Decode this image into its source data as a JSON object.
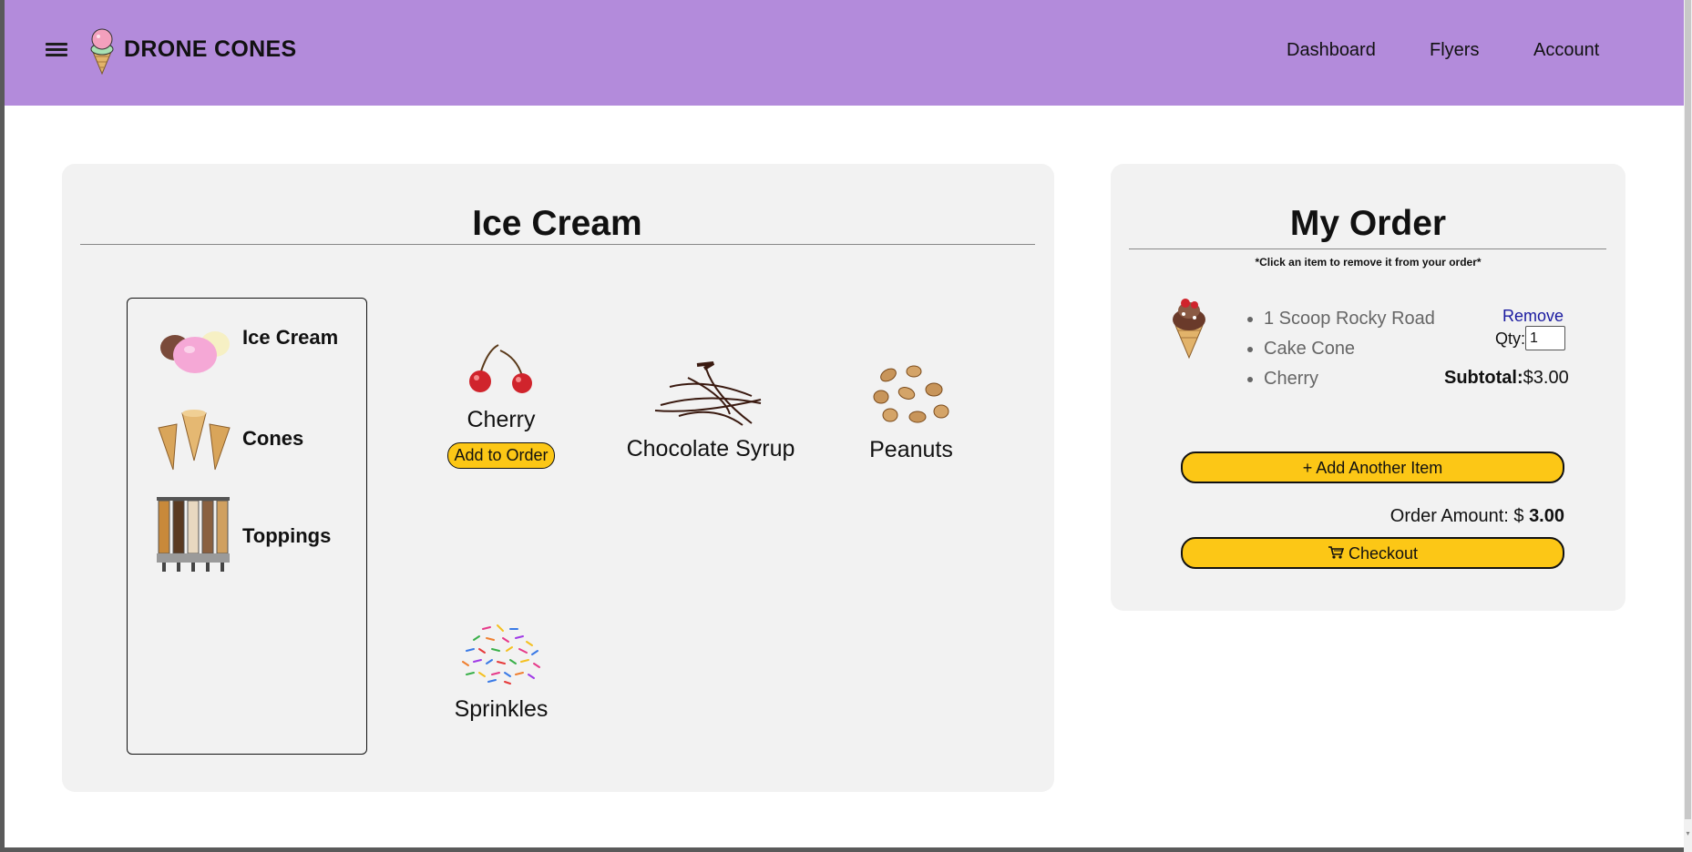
{
  "header": {
    "brand": "DRONE CONES",
    "nav": [
      "Dashboard",
      "Flyers",
      "Account"
    ]
  },
  "menu": {
    "title": "Ice Cream",
    "categories": [
      {
        "label": "Ice Cream",
        "icon": "ice-cream-scoops-icon"
      },
      {
        "label": "Cones",
        "icon": "cones-icon"
      },
      {
        "label": "Toppings",
        "icon": "toppings-dispenser-icon"
      }
    ],
    "products": [
      {
        "name": "Cherry",
        "icon": "cherry-icon",
        "action": "Add to Order"
      },
      {
        "name": "Chocolate Syrup",
        "icon": "chocolate-syrup-icon"
      },
      {
        "name": "Peanuts",
        "icon": "peanuts-icon"
      },
      {
        "name": "Sprinkles",
        "icon": "sprinkles-icon"
      }
    ]
  },
  "order": {
    "title": "My Order",
    "hint": "*Click an item to remove it from your order*",
    "item": {
      "lines": [
        "1 Scoop Rocky Road",
        "Cake Cone",
        "Cherry"
      ],
      "remove": "Remove",
      "qty_label": "Qty:",
      "qty_value": "1",
      "subtotal_label": "Subtotal:",
      "subtotal_value": "$3.00"
    },
    "add_another": "+ Add Another Item",
    "amount_label": "Order Amount: $ ",
    "amount_value": "3.00",
    "checkout": "Checkout"
  },
  "colors": {
    "header_bg": "#b38bdb",
    "button_yellow": "#fcc716",
    "panel_bg": "#f2f2f2",
    "link": "#1a1aa0"
  }
}
